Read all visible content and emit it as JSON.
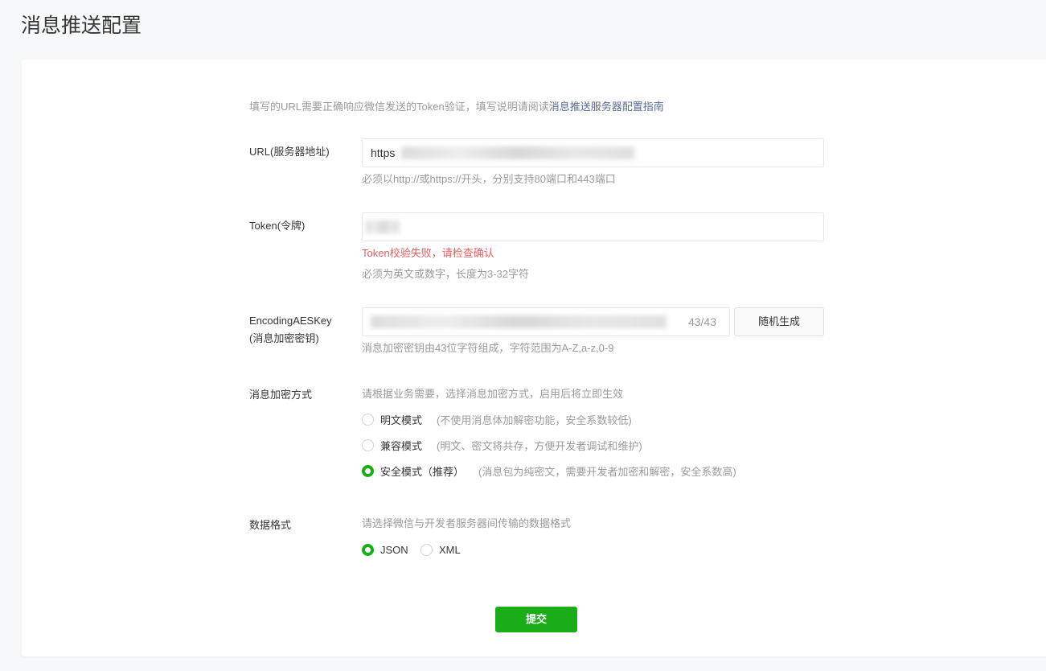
{
  "page": {
    "title": "消息推送配置"
  },
  "intro": {
    "text": "填写的URL需要正确响应微信发送的Token验证，填写说明请阅读",
    "link": "消息推送服务器配置指南"
  },
  "url": {
    "label": "URL(服务器地址)",
    "value": "https",
    "hint": "必须以http://或https://开头，分别支持80端口和443端口"
  },
  "token": {
    "label": "Token(令牌)",
    "error": "Token校验失败，请检查确认",
    "hint": "必须为英文或数字，长度为3-32字符"
  },
  "aeskey": {
    "label_line1": "EncodingAESKey",
    "label_line2": "(消息加密密钥)",
    "counter": "43/43",
    "generate_button": "随机生成",
    "hint": "消息加密密钥由43位字符组成，字符范围为A-Z,a-z,0-9"
  },
  "encryption": {
    "label": "消息加密方式",
    "hint": "请根据业务需要，选择消息加密方式，启用后将立即生效",
    "options": [
      {
        "label": "明文模式",
        "desc": "(不使用消息体加解密功能，安全系数较低)",
        "checked": false
      },
      {
        "label": "兼容模式",
        "desc": "(明文、密文将共存，方便开发者调试和维护)",
        "checked": false
      },
      {
        "label": "安全模式（推荐）",
        "desc": "(消息包为纯密文，需要开发者加密和解密，安全系数高)",
        "checked": true
      }
    ]
  },
  "format": {
    "label": "数据格式",
    "hint": "请选择微信与开发者服务器间传输的数据格式",
    "options": [
      {
        "label": "JSON",
        "checked": true
      },
      {
        "label": "XML",
        "checked": false
      }
    ]
  },
  "submit_label": "提交",
  "colors": {
    "primary": "#1aad19",
    "link": "#576b95",
    "error": "#e15f63"
  }
}
